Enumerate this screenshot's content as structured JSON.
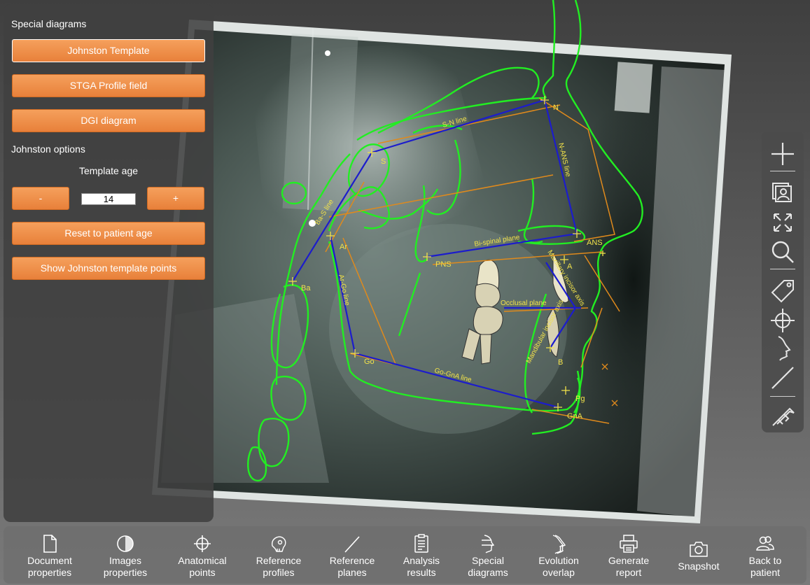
{
  "special_diagrams": {
    "heading": "Special diagrams",
    "buttons": [
      "Johnston Template",
      "STGA Profile field",
      "DGI diagram"
    ]
  },
  "johnston_options": {
    "heading": "Johnston options",
    "template_age_label": "Template age",
    "age_value": "14",
    "decrement_label": "-",
    "increment_label": "+",
    "reset_label": "Reset to patient age",
    "show_points_label": "Show Johnston template points"
  },
  "ceph_labels": {
    "points": [
      "N",
      "S",
      "ANS",
      "A",
      "PNS",
      "Ar",
      "Ba",
      "Go",
      "B",
      "Pg",
      "GnA"
    ],
    "lines": [
      "S-N line",
      "N-ANS line",
      "Ba-S line",
      "Bi-spinal plane",
      "Occlusal plane",
      "Ar-Go line",
      "Go-GnA line",
      "Maxillary incisor axis",
      "Mandibular incisor axis"
    ]
  },
  "right_tools": [
    "add-point",
    "images",
    "fit-to-screen",
    "zoom",
    "label",
    "crosshair",
    "profile",
    "line",
    "caliper"
  ],
  "bottom_bar": [
    {
      "label": "Document\nproperties"
    },
    {
      "label": "Images\nproperties"
    },
    {
      "label": "Anatomical\npoints"
    },
    {
      "label": "Reference\nprofiles"
    },
    {
      "label": "Reference\nplanes"
    },
    {
      "label": "Analysis\nresults"
    },
    {
      "label": "Special\ndiagrams"
    },
    {
      "label": "Evolution\noverlap"
    },
    {
      "label": "Generate\nreport"
    },
    {
      "label": "Snapshot"
    },
    {
      "label": "Back to\npatient"
    }
  ],
  "colors": {
    "accent_orange": "#ec8a42",
    "tracing_green": "#22ee22",
    "plane_blue": "#1c1ccc",
    "template_orange": "#e08a1c",
    "label_yellow": "#f2e24a"
  }
}
